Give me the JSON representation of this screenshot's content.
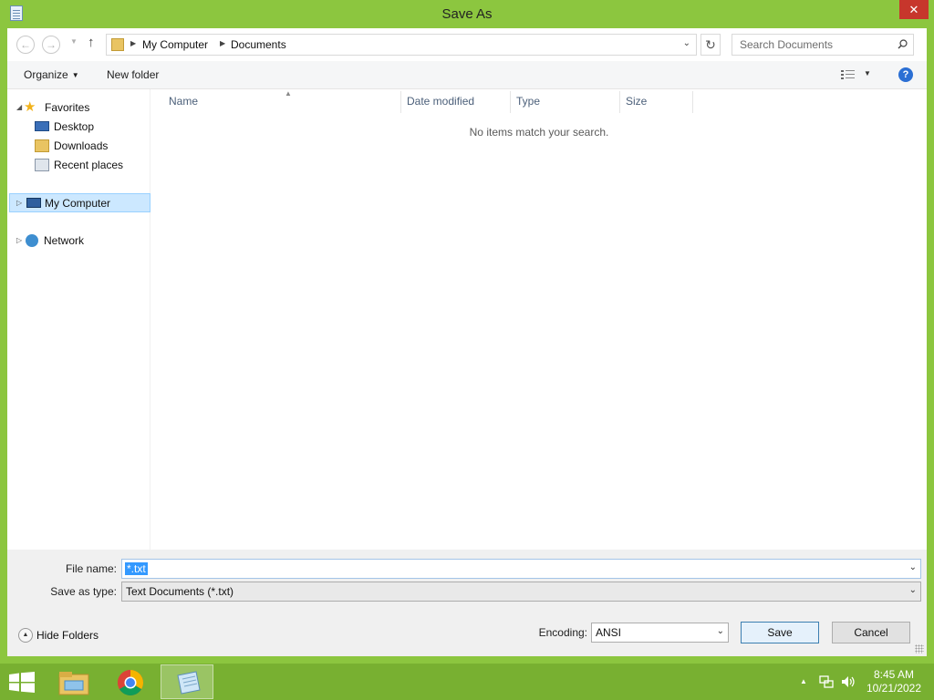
{
  "window": {
    "title": "Save As",
    "close_label": "✕"
  },
  "nav": {
    "back_label": "←",
    "forward_label": "→",
    "history_caret": "▼",
    "up_label": "↑",
    "breadcrumb": [
      "My Computer",
      "Documents"
    ],
    "refresh_label": "↻",
    "search_placeholder": "Search Documents"
  },
  "toolbar": {
    "organize_label": "Organize",
    "new_folder_label": "New folder",
    "help_label": "?"
  },
  "navpane": {
    "favorites": "Favorites",
    "items": [
      "Desktop",
      "Downloads",
      "Recent places"
    ],
    "computer": "My Computer",
    "network": "Network"
  },
  "filelist": {
    "columns": [
      "Name",
      "Date modified",
      "Type",
      "Size"
    ],
    "empty_message": "No items match your search."
  },
  "form": {
    "file_name_label": "File name:",
    "file_name_value": "*.txt",
    "save_as_type_label": "Save as type:",
    "save_as_type_value": "Text Documents (*.txt)",
    "encoding_label": "Encoding:",
    "encoding_value": "ANSI",
    "save_label": "Save",
    "cancel_label": "Cancel",
    "hide_folders_label": "Hide Folders"
  },
  "taskbar": {
    "apps": [
      "file-explorer-icon",
      "chrome-icon",
      "notepad-icon"
    ],
    "active_app": "notepad-icon",
    "clock_time": "8:45 AM",
    "clock_date": "10/21/2022"
  },
  "colors": {
    "accent": "#8cc63f",
    "taskbar": "#78b031",
    "close": "#c7362c",
    "selection": "#3399ff"
  }
}
